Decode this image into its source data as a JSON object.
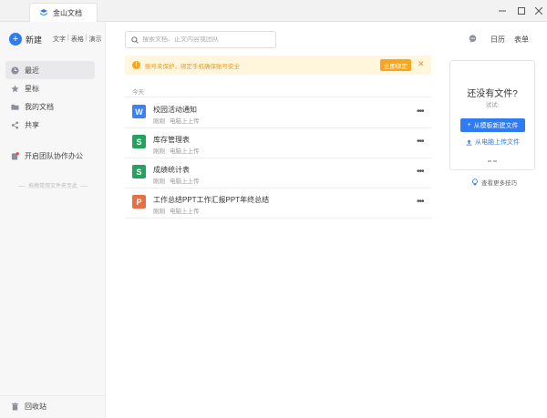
{
  "window": {
    "tab_title": "金山文档",
    "controls": [
      "minimize-icon",
      "maximize-icon",
      "close-icon"
    ]
  },
  "sidebar": {
    "new_label": "新建",
    "doc_types": [
      "文字",
      "表格",
      "演示"
    ],
    "items": [
      {
        "label": "最近",
        "icon": "clock-icon",
        "active": true
      },
      {
        "label": "星标",
        "icon": "star-icon",
        "active": false
      },
      {
        "label": "我的文档",
        "icon": "folder-icon",
        "active": false
      },
      {
        "label": "共享",
        "icon": "share-icon",
        "active": false
      },
      {
        "label": "开启团队协作办公",
        "icon": "team-icon",
        "active": false
      }
    ],
    "divider_text": "拖拽常用文件夹至此",
    "recycle_label": "回收站"
  },
  "main": {
    "search_placeholder": "搜索文档、正文内容或团队",
    "top_right": {
      "calendar": "日历",
      "form": "表单"
    },
    "banner": {
      "message": "账号未保护，绑定手机确保账号安全",
      "button": "立即绑定"
    },
    "section_label": "今天",
    "files": [
      {
        "name": "校园活动通知",
        "time": "刚刚",
        "source": "电脑上上传",
        "type": "W",
        "color": "#3d7ff5"
      },
      {
        "name": "库存管理表",
        "time": "刚刚",
        "source": "电脑上上传",
        "type": "S",
        "color": "#23a45e"
      },
      {
        "name": "成绩统计表",
        "time": "刚刚",
        "source": "电脑上上传",
        "type": "S",
        "color": "#23a45e"
      },
      {
        "name": "工作总结PPT工作汇报PPT年终总结",
        "time": "刚刚",
        "source": "电脑上上传",
        "type": "P",
        "color": "#e86e43"
      }
    ]
  },
  "empty_panel": {
    "title": "还没有文件?",
    "subtitle": "试试:",
    "template_button": "从模板新建文件",
    "upload_link": "从电脑上传文件",
    "tips": "查看更多技巧"
  },
  "colors": {
    "accent": "#2f7bf6",
    "warning": "#f5a623",
    "banner_bg": "#fff6dc"
  }
}
